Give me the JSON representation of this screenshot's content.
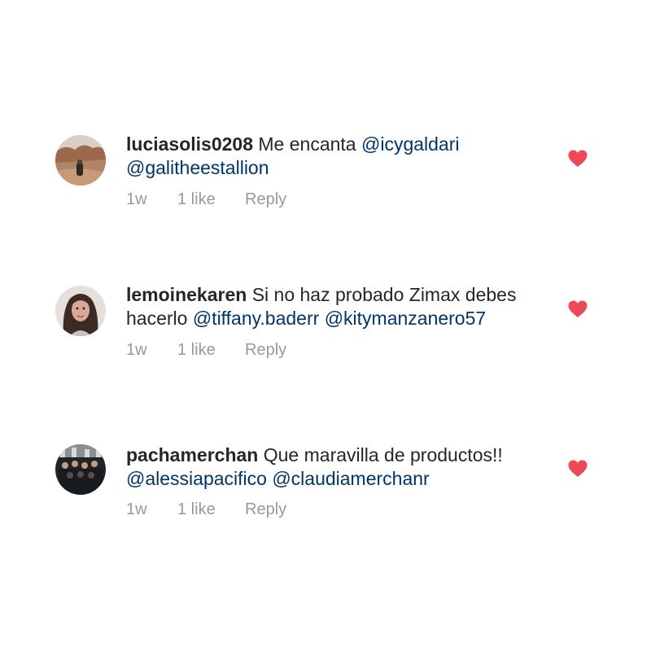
{
  "comments": [
    {
      "username": "luciasolis0208",
      "text_line1": "Me encanta ",
      "mention1": "@icygaldari",
      "mention2": "@galitheestallion",
      "time": "1w",
      "likes": "1 like",
      "reply": "Reply",
      "heart_color": "#ed4956"
    },
    {
      "username": "lemoinekaren",
      "text_line1": "Si no haz probado Zimax debes",
      "text_line2": "hacerlo ",
      "mention1": "@tiffany.baderr",
      "mention2": "@kitymanzanero57",
      "time": "1w",
      "likes": "1 like",
      "reply": "Reply",
      "heart_color": "#ed4956"
    },
    {
      "username": "pachamerchan",
      "text_line1": "Que maravilla de productos!!",
      "mention1": "@alessiapacifico",
      "mention2": "@claudiamerchanr",
      "time": "1w",
      "likes": "1 like",
      "reply": "Reply",
      "heart_color": "#ed4956"
    }
  ],
  "colors": {
    "mention": "#003569",
    "meta": "#999999",
    "text": "#262626",
    "heart": "#ed4956"
  },
  "icons": {
    "like": "heart-filled-icon"
  }
}
